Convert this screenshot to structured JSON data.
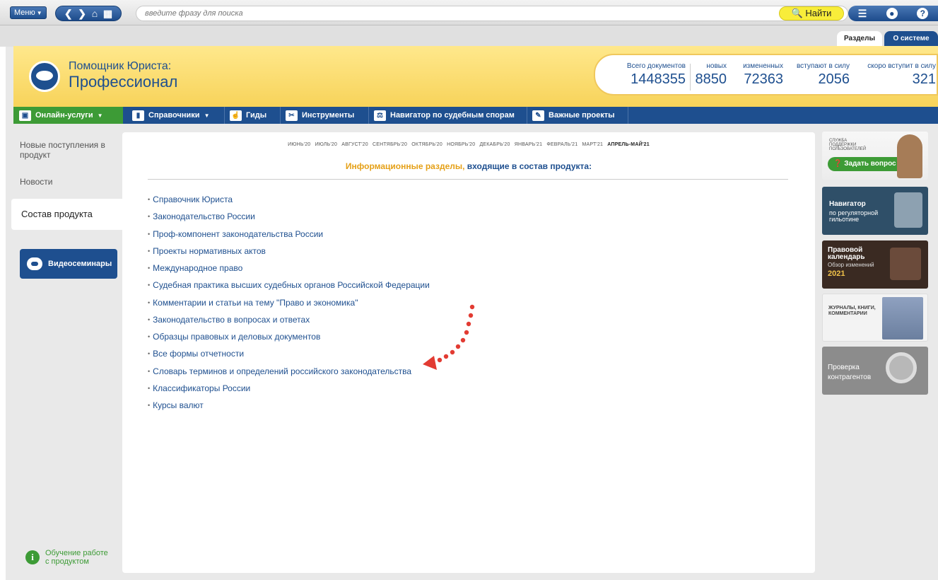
{
  "topbar": {
    "menu_label": "Меню",
    "search_placeholder": "введите фразу для поиска",
    "find_label": "Найти"
  },
  "tabs": {
    "sections": "Разделы",
    "about": "О системе"
  },
  "brand": {
    "line1": "Помощник Юриста:",
    "line2": "Профессионал"
  },
  "stats": [
    {
      "label": "Всего документов",
      "value": "1448355"
    },
    {
      "label": "новых",
      "value": "8850"
    },
    {
      "label": "измененных",
      "value": "72363"
    },
    {
      "label": "вступают в силу",
      "value": "2056"
    },
    {
      "label": "скоро вступит в силу",
      "value": "321"
    }
  ],
  "toolbar": {
    "online": "Онлайн-услуги",
    "directories": "Справочники",
    "guides": "Гиды",
    "tools": "Инструменты",
    "navigator": "Навигатор по судебным спорам",
    "projects": "Важные проекты"
  },
  "sidebar": {
    "new_arrivals": "Новые поступления в продукт",
    "news": "Новости",
    "product": "Состав продукта",
    "webinars": "Видеосеминары",
    "learn": "Обучение работе с продуктом"
  },
  "months": [
    "ИЮНЬ'20",
    "ИЮЛЬ'20",
    "АВГУСТ'20",
    "СЕНТЯБРЬ'20",
    "ОКТЯБРЬ'20",
    "НОЯБРЬ'20",
    "ДЕКАБРЬ'20",
    "ЯНВАРЬ'21",
    "ФЕВРАЛЬ'21",
    "МАРТ'21",
    "АПРЕЛЬ-МАЙ'21"
  ],
  "section_title": {
    "highlight": "Информационные разделы,",
    "rest": " входящие в состав продукта:"
  },
  "sections": [
    "Справочник Юриста",
    "Законодательство России",
    "Проф-компонент законодательства России",
    "Проекты нормативных актов",
    "Международное право",
    "Судебная практика высших судебных органов Российской Федерации",
    "Комментарии и статьи на тему \"Право и экономика\"",
    "Законодательство в вопросах и ответах",
    "Образцы правовых и деловых документов",
    "Все формы отчетности",
    "Словарь терминов и определений российского законодательства",
    "Классификаторы России",
    "Курсы валют"
  ],
  "right": {
    "support": "СЛУЖБА ПОДДЕРЖКИ ПОЛЬЗОВАТЕЛЕЙ",
    "ask": "Задать вопрос",
    "guillotine_title": "Навигатор",
    "guillotine_sub": "по регуляторной гильотине",
    "calendar_title": "Правовой календарь",
    "calendar_sub": "Обзор изменений",
    "calendar_year": "2021",
    "journals": "ЖУРНАЛЫ, КНИГИ, КОММЕНТАРИИ",
    "check": "Проверка контрагентов"
  },
  "colors": {
    "brand_blue": "#1e4f8f",
    "green": "#3d9b36",
    "yellow": "#f7d35a",
    "orange": "#e5a017"
  }
}
